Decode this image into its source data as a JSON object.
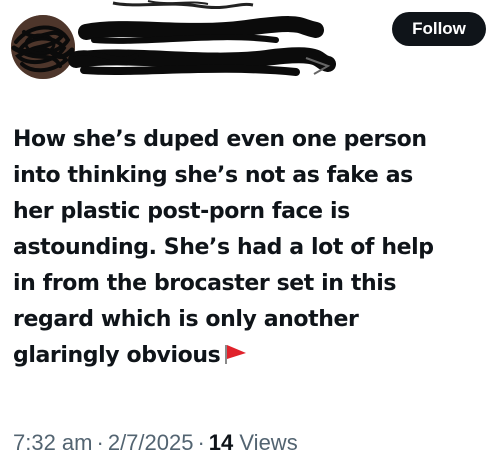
{
  "header": {
    "follow_label": "Follow"
  },
  "post": {
    "text_lines": [
      "How she’s duped even one person",
      "into thinking she’s not as fake as",
      "her plastic post-porn face is",
      "astounding. She’s had a lot of help",
      "in from the brocaster set in this",
      "regard which is only another",
      "glaringly obvious"
    ],
    "trailing_emoji": "red-flag-icon"
  },
  "meta": {
    "time": "7:32 am",
    "separator": "·",
    "date": "2/7/2025",
    "views_count": "14",
    "views_label": "Views"
  },
  "colors": {
    "text": "#0f1419",
    "secondary_text": "#536471",
    "follow_bg": "#0f1419",
    "flag_red": "#e0222b"
  }
}
